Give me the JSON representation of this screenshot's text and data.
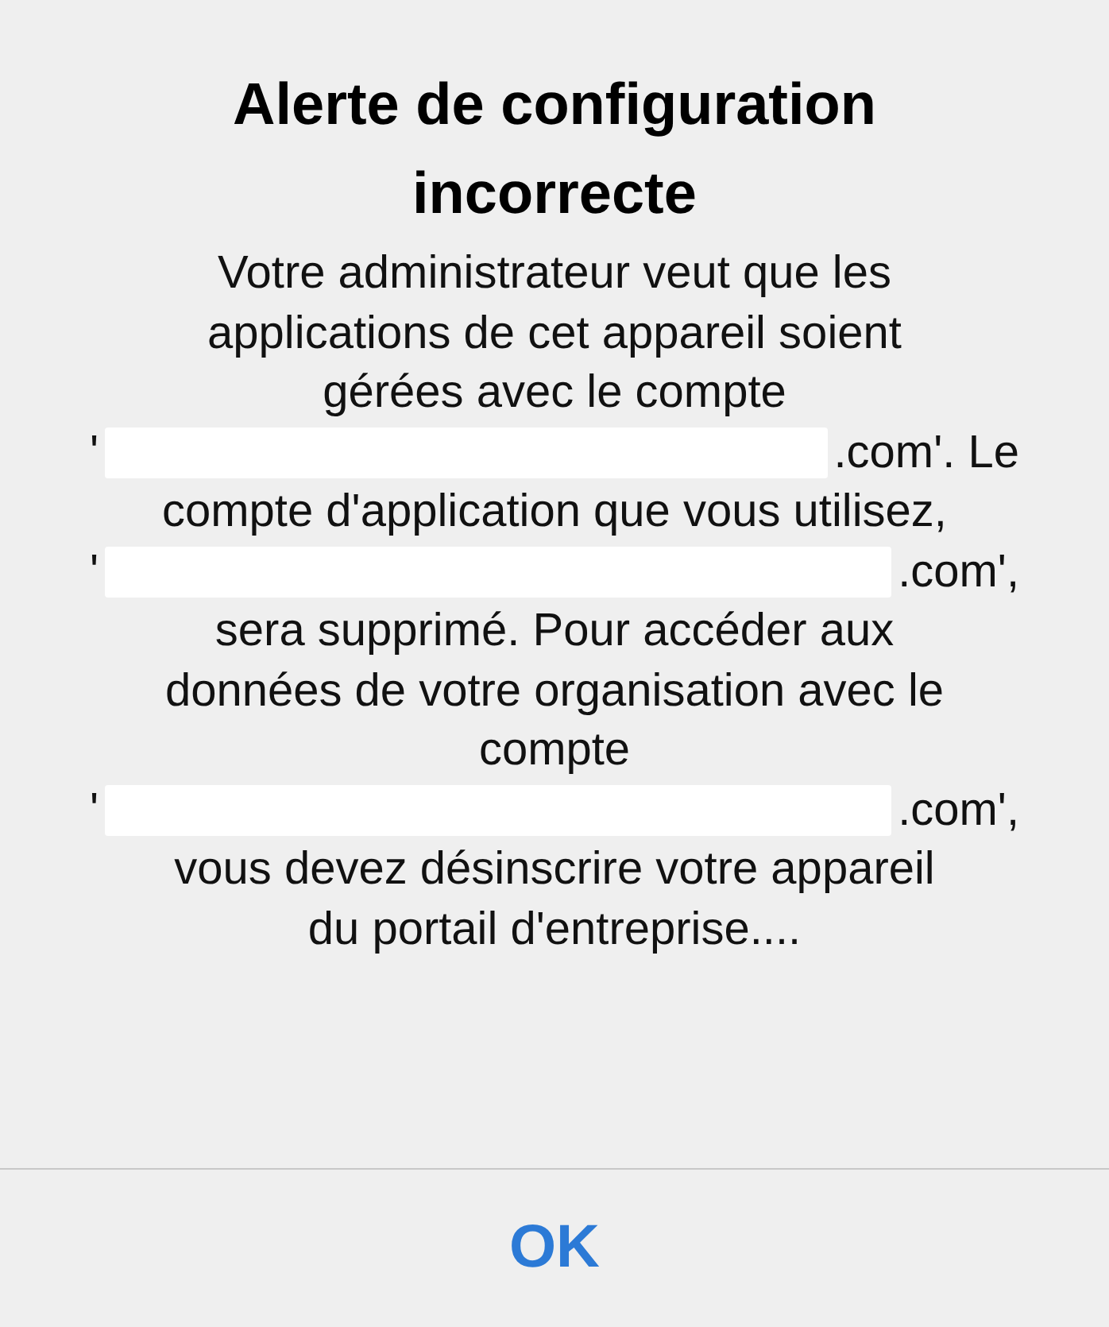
{
  "alert": {
    "title": "Alerte de configuration incorrecte",
    "message_lines": [
      [
        {
          "kind": "text",
          "text": "Votre administrateur veut que les"
        }
      ],
      [
        {
          "kind": "text",
          "text": "applications de cet appareil soient"
        }
      ],
      [
        {
          "kind": "text",
          "text": "gérées avec le compte"
        }
      ],
      [
        {
          "kind": "text",
          "text": "'"
        },
        {
          "kind": "redacted"
        },
        {
          "kind": "text",
          "text": ".com'. Le"
        }
      ],
      [
        {
          "kind": "text",
          "text": "compte d'application que vous utilisez,"
        }
      ],
      [
        {
          "kind": "text",
          "text": "'"
        },
        {
          "kind": "redacted"
        },
        {
          "kind": "text",
          "text": ".com',"
        }
      ],
      [
        {
          "kind": "text",
          "text": "sera supprimé. Pour accéder aux"
        }
      ],
      [
        {
          "kind": "text",
          "text": "données de votre organisation avec le"
        }
      ],
      [
        {
          "kind": "text",
          "text": "compte"
        }
      ],
      [
        {
          "kind": "text",
          "text": "'"
        },
        {
          "kind": "redacted"
        },
        {
          "kind": "text",
          "text": ".com',"
        }
      ],
      [
        {
          "kind": "text",
          "text": "vous devez désinscrire votre appareil"
        }
      ],
      [
        {
          "kind": "text",
          "text": "du portail d'entreprise...."
        }
      ]
    ],
    "button": "OK"
  }
}
